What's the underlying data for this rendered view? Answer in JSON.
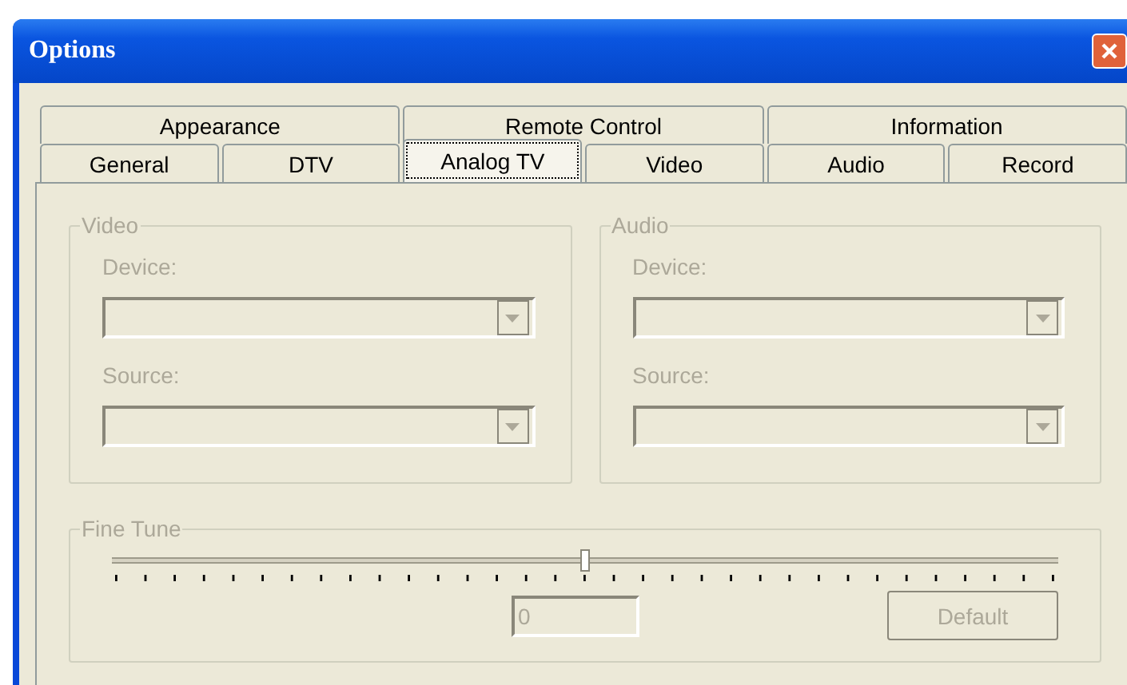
{
  "window": {
    "title": "Options"
  },
  "tab_rows": [
    [
      {
        "label": "Appearance",
        "selected": false
      },
      {
        "label": "Remote Control",
        "selected": false
      },
      {
        "label": "Information",
        "selected": false
      }
    ],
    [
      {
        "label": "General",
        "selected": false
      },
      {
        "label": "DTV",
        "selected": false
      },
      {
        "label": "Analog TV",
        "selected": true
      },
      {
        "label": "Video",
        "selected": false
      },
      {
        "label": "Audio",
        "selected": false
      },
      {
        "label": "Record",
        "selected": false
      }
    ]
  ],
  "groups": [
    {
      "title": "Video",
      "disabled": true,
      "fields": [
        {
          "label": "Device:"
        },
        {
          "label": "Source:"
        }
      ]
    },
    {
      "title": "Audio",
      "disabled": true,
      "fields": [
        {
          "label": "Device:"
        },
        {
          "label": "Source:"
        }
      ]
    }
  ],
  "fine_tune": {
    "title": "Fine Tune",
    "disabled": true,
    "level": 0.5,
    "value": "0",
    "button": "Default"
  }
}
